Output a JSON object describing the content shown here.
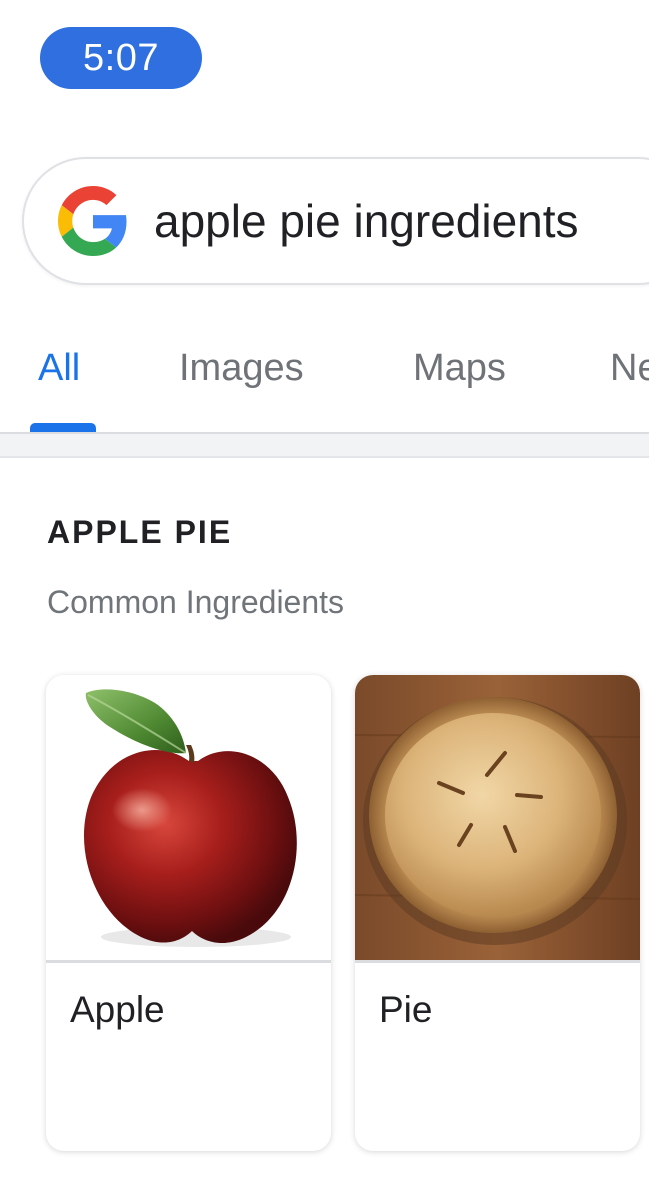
{
  "status_bar": {
    "time": "5:07"
  },
  "search": {
    "query": "apple pie ingredients"
  },
  "tabs": [
    {
      "label": "All",
      "active": true
    },
    {
      "label": "Images",
      "active": false
    },
    {
      "label": "Maps",
      "active": false
    },
    {
      "label": "News",
      "active": false
    }
  ],
  "knowledge": {
    "title": "APPLE PIE",
    "subtitle": "Common Ingredients",
    "items": [
      {
        "label": "Apple",
        "icon": "apple-image"
      },
      {
        "label": "Pie",
        "icon": "pie-image"
      }
    ]
  },
  "colors": {
    "accent": "#1a73e8",
    "status_pill": "#2f6fe0",
    "text_primary": "#202124",
    "text_secondary": "#70757a"
  }
}
